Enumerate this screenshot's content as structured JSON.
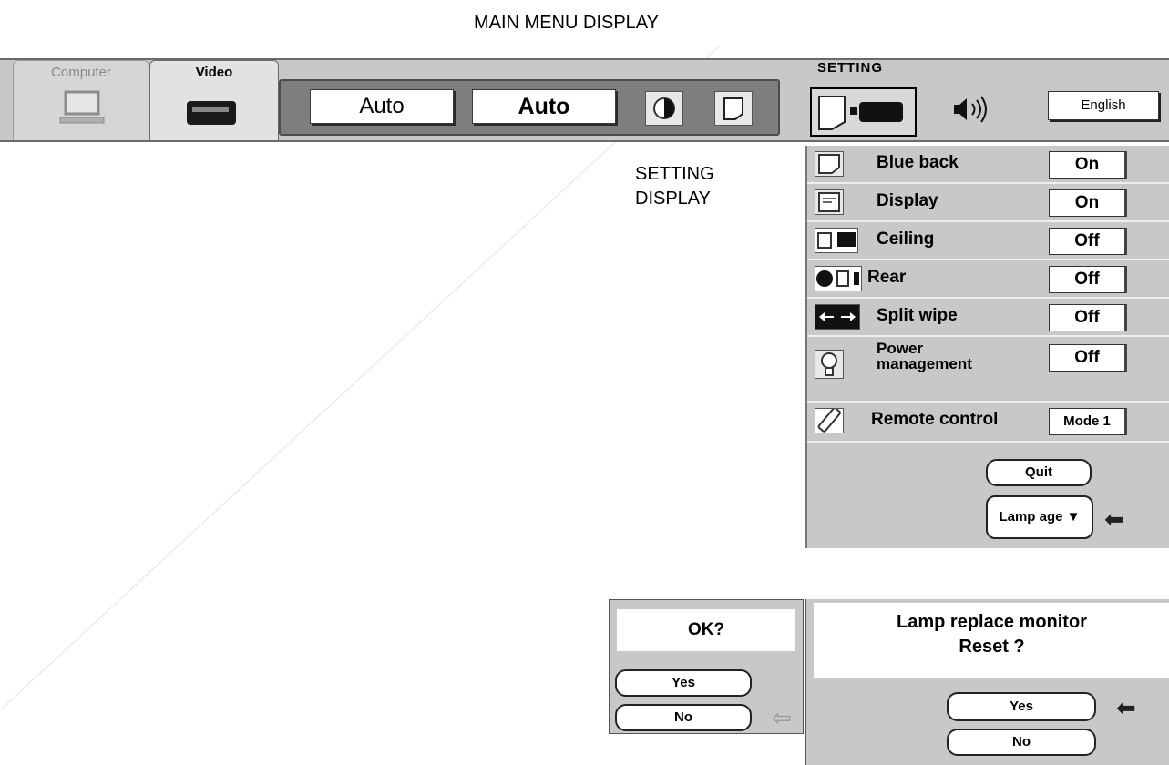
{
  "headings": {
    "main_menu": "MAIN MENU DISPLAY",
    "setting_display_line1": "SETTING",
    "setting_display_line2": "DISPLAY"
  },
  "menubar": {
    "tab_computer": "Computer",
    "tab_video": "Video",
    "auto_1": "Auto",
    "auto_2": "Auto",
    "setting_title": "SETTING",
    "language": "English"
  },
  "settings": [
    {
      "label": "Blue back",
      "value": "On",
      "icon": "blue-back-icon"
    },
    {
      "label": "Display",
      "value": "On",
      "icon": "display-icon"
    },
    {
      "label": "Ceiling",
      "value": "Off",
      "icon": "ceiling-icon"
    },
    {
      "label": "Rear",
      "value": "Off",
      "icon": "rear-icon"
    },
    {
      "label": "Split wipe",
      "value": "Off",
      "icon": "split-wipe-icon"
    },
    {
      "label_line1": "Power",
      "label_line2": "management",
      "value": "Off",
      "icon": "power-management-icon"
    },
    {
      "label": "Remote control",
      "value": "Mode 1",
      "icon": "remote-control-icon"
    }
  ],
  "panel_buttons": {
    "quit": "Quit",
    "lamp_age": "Lamp age"
  },
  "ok_dialog": {
    "title": "OK?",
    "yes": "Yes",
    "no": "No"
  },
  "reset_dialog": {
    "title_line1": "Lamp replace monitor",
    "title_line2": "Reset ?",
    "yes": "Yes",
    "no": "No"
  }
}
